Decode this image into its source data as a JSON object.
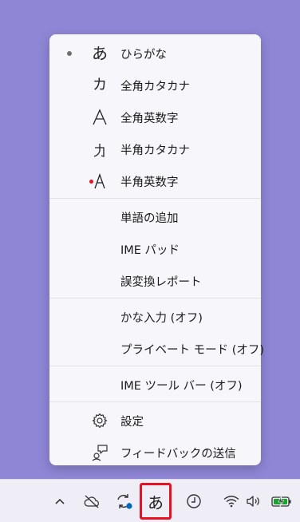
{
  "menu": {
    "input_modes": [
      {
        "glyph": "あ",
        "label": "ひらがな",
        "selected": true
      },
      {
        "glyph": "カ",
        "label": "全角カタカナ"
      },
      {
        "glyph": "A",
        "label": "全角英数字"
      },
      {
        "glyph": "ｶ",
        "label": "半角カタカナ"
      },
      {
        "glyph": "A",
        "label": "半角英数字",
        "marker": "red-dot"
      }
    ],
    "tools": [
      {
        "label": "単語の追加"
      },
      {
        "label": "IME パッド"
      },
      {
        "label": "誤変換レポート"
      }
    ],
    "options": [
      {
        "label": "かな入力 (オフ)"
      },
      {
        "label": "プライベート モード (オフ)"
      }
    ],
    "toolbar": [
      {
        "label": "IME ツール バー (オフ)"
      }
    ],
    "footer": [
      {
        "icon": "gear-icon",
        "label": "設定"
      },
      {
        "icon": "feedback-icon",
        "label": "フィードバックの送信"
      }
    ]
  },
  "taskbar": {
    "ime_indicator": "あ",
    "icons": [
      "chevron-up-icon",
      "cloud-off-icon",
      "sync-icon",
      "ime-indicator",
      "focus-clock-icon",
      "wifi-icon",
      "speaker-icon",
      "battery-charging-icon"
    ]
  },
  "colors": {
    "desktop": "#8f86d6",
    "menu_bg": "#f7f7fb",
    "highlight_border": "#e81123",
    "status_blue": "#0067c0",
    "battery_green": "#1aa32a"
  }
}
